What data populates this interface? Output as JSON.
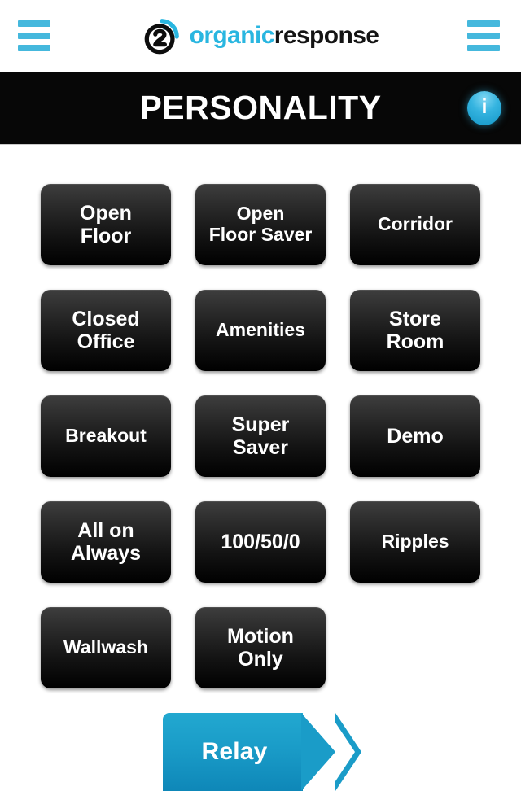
{
  "header": {
    "left_menu_icon": "hamburger-menu-icon",
    "right_menu_icon": "hamburger-menu-icon",
    "brand": {
      "icon": "organic-response-logo-icon",
      "word1": "organic",
      "word2": "response"
    },
    "accent_color": "#45b8dd"
  },
  "titlebar": {
    "title": "PERSONALITY",
    "info_label": "i",
    "info_icon": "info-circle-icon",
    "background": "#070707",
    "info_color": "#35b4e0"
  },
  "grid": {
    "buttons": [
      {
        "label": "Open\nFloor"
      },
      {
        "label": "Open\nFloor Saver"
      },
      {
        "label": "Corridor"
      },
      {
        "label": "Closed\nOffice"
      },
      {
        "label": "Amenities"
      },
      {
        "label": "Store\nRoom"
      },
      {
        "label": "Breakout"
      },
      {
        "label": "Super\nSaver"
      },
      {
        "label": "Demo"
      },
      {
        "label": "All on\nAlways"
      },
      {
        "label": "100/50/0"
      },
      {
        "label": "Ripples"
      },
      {
        "label": "Wallwash"
      },
      {
        "label": "Motion\nOnly"
      }
    ]
  },
  "footer": {
    "relay_label": "Relay",
    "relay_color": "#1a9cc8",
    "chevron_icon": "chevron-right-icon"
  }
}
